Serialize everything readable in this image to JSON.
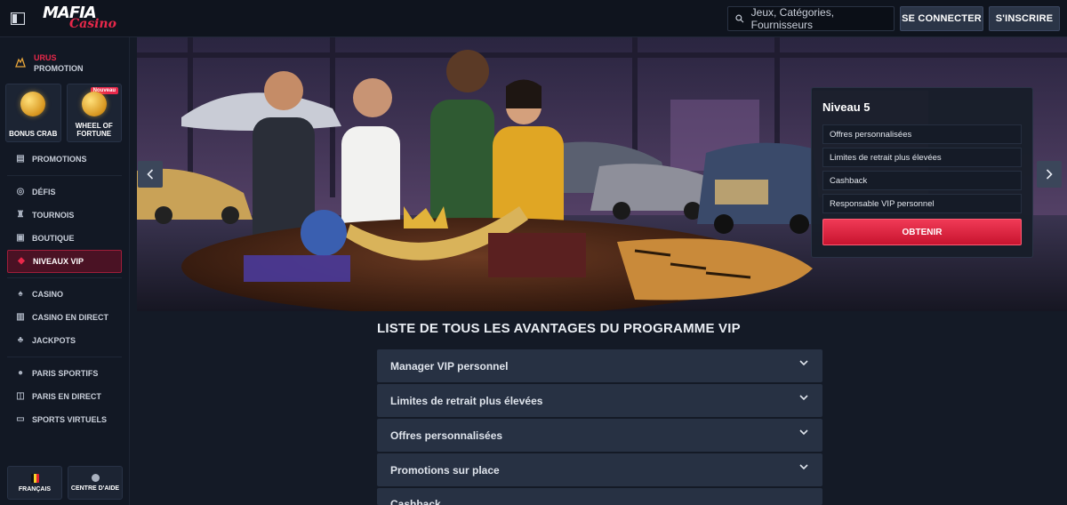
{
  "topbar": {
    "logo_main": "MAFIA",
    "logo_sub": "Casino",
    "search_placeholder": "Jeux, Catégories, Fournisseurs",
    "login_label": "SE CONNECTER",
    "register_label": "S'INSCRIRE"
  },
  "sidebar": {
    "promo": {
      "line1": "URUS",
      "line2": "PROMOTION"
    },
    "tiles": [
      {
        "label": "BONUS CRAB",
        "badge": ""
      },
      {
        "label": "WHEEL OF FORTUNE",
        "badge": "Nouveau"
      }
    ],
    "items": [
      {
        "label": "PROMOTIONS",
        "icon": "megaphone-icon"
      },
      {
        "label": "DÉFIS",
        "icon": "target-icon"
      },
      {
        "label": "TOURNOIS",
        "icon": "trophy-icon"
      },
      {
        "label": "BOUTIQUE",
        "icon": "shop-icon"
      },
      {
        "label": "NIVEAUX VIP",
        "icon": "diamond-icon"
      },
      {
        "label": "CASINO",
        "icon": "spade-icon"
      },
      {
        "label": "CASINO EN DIRECT",
        "icon": "live-cards-icon"
      },
      {
        "label": "JACKPOTS",
        "icon": "clover-icon"
      },
      {
        "label": "PARIS SPORTIFS",
        "icon": "soccer-ball-icon"
      },
      {
        "label": "PARIS EN DIRECT",
        "icon": "live-bet-icon"
      },
      {
        "label": "SPORTS VIRTUELS",
        "icon": "virtual-sports-icon"
      }
    ],
    "bottom": {
      "language_label": "FRANÇAIS",
      "help_label": "CENTRE D'AIDE"
    }
  },
  "vip_card": {
    "level": "Niveau 5",
    "perks": [
      "Offres personnalisées",
      "Limites de retrait plus élevées",
      "Cashback",
      "Responsable VIP personnel"
    ],
    "button_label": "OBTENIR"
  },
  "benefits": {
    "title": "LISTE DE TOUS LES AVANTAGES DU PROGRAMME VIP",
    "items": [
      "Manager VIP personnel",
      "Limites de retrait plus élevées",
      "Offres personnalisées",
      "Promotions sur place",
      "Cashback"
    ]
  },
  "colors": {
    "accent": "#e8284a",
    "background": "#141a26",
    "panel": "#273143"
  }
}
